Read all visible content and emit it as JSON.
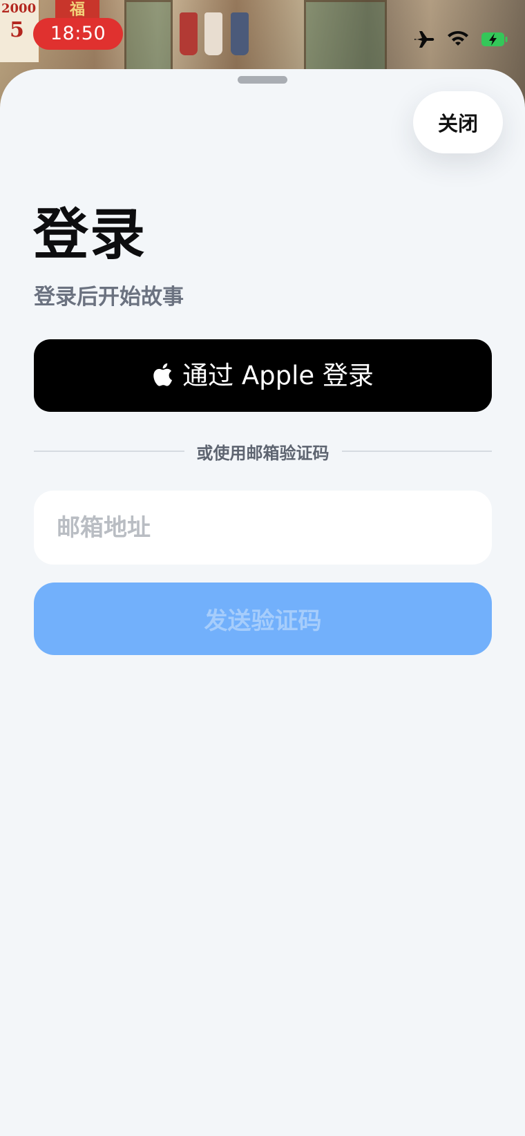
{
  "status_bar": {
    "time": "18:50",
    "icons": [
      "airplane-icon",
      "wifi-icon",
      "battery-charging-icon"
    ],
    "time_pill_color": "#e0312f",
    "battery_color": "#34c759"
  },
  "background": {
    "calendar_year": "2000",
    "calendar_day": "5",
    "fu_sign": "福"
  },
  "sheet": {
    "close_label": "关闭",
    "title": "登录",
    "subtitle": "登录后开始故事",
    "apple_button": {
      "icon": "apple-logo-icon",
      "label": "通过 Apple 登录"
    },
    "divider_text": "或使用邮箱验证码",
    "email_field": {
      "placeholder": "邮箱地址",
      "value": ""
    },
    "send_button_label": "发送验证码",
    "colors": {
      "sheet_bg": "#f3f6f9",
      "apple_button_bg": "#000000",
      "send_button_bg": "#72b0fb"
    }
  }
}
